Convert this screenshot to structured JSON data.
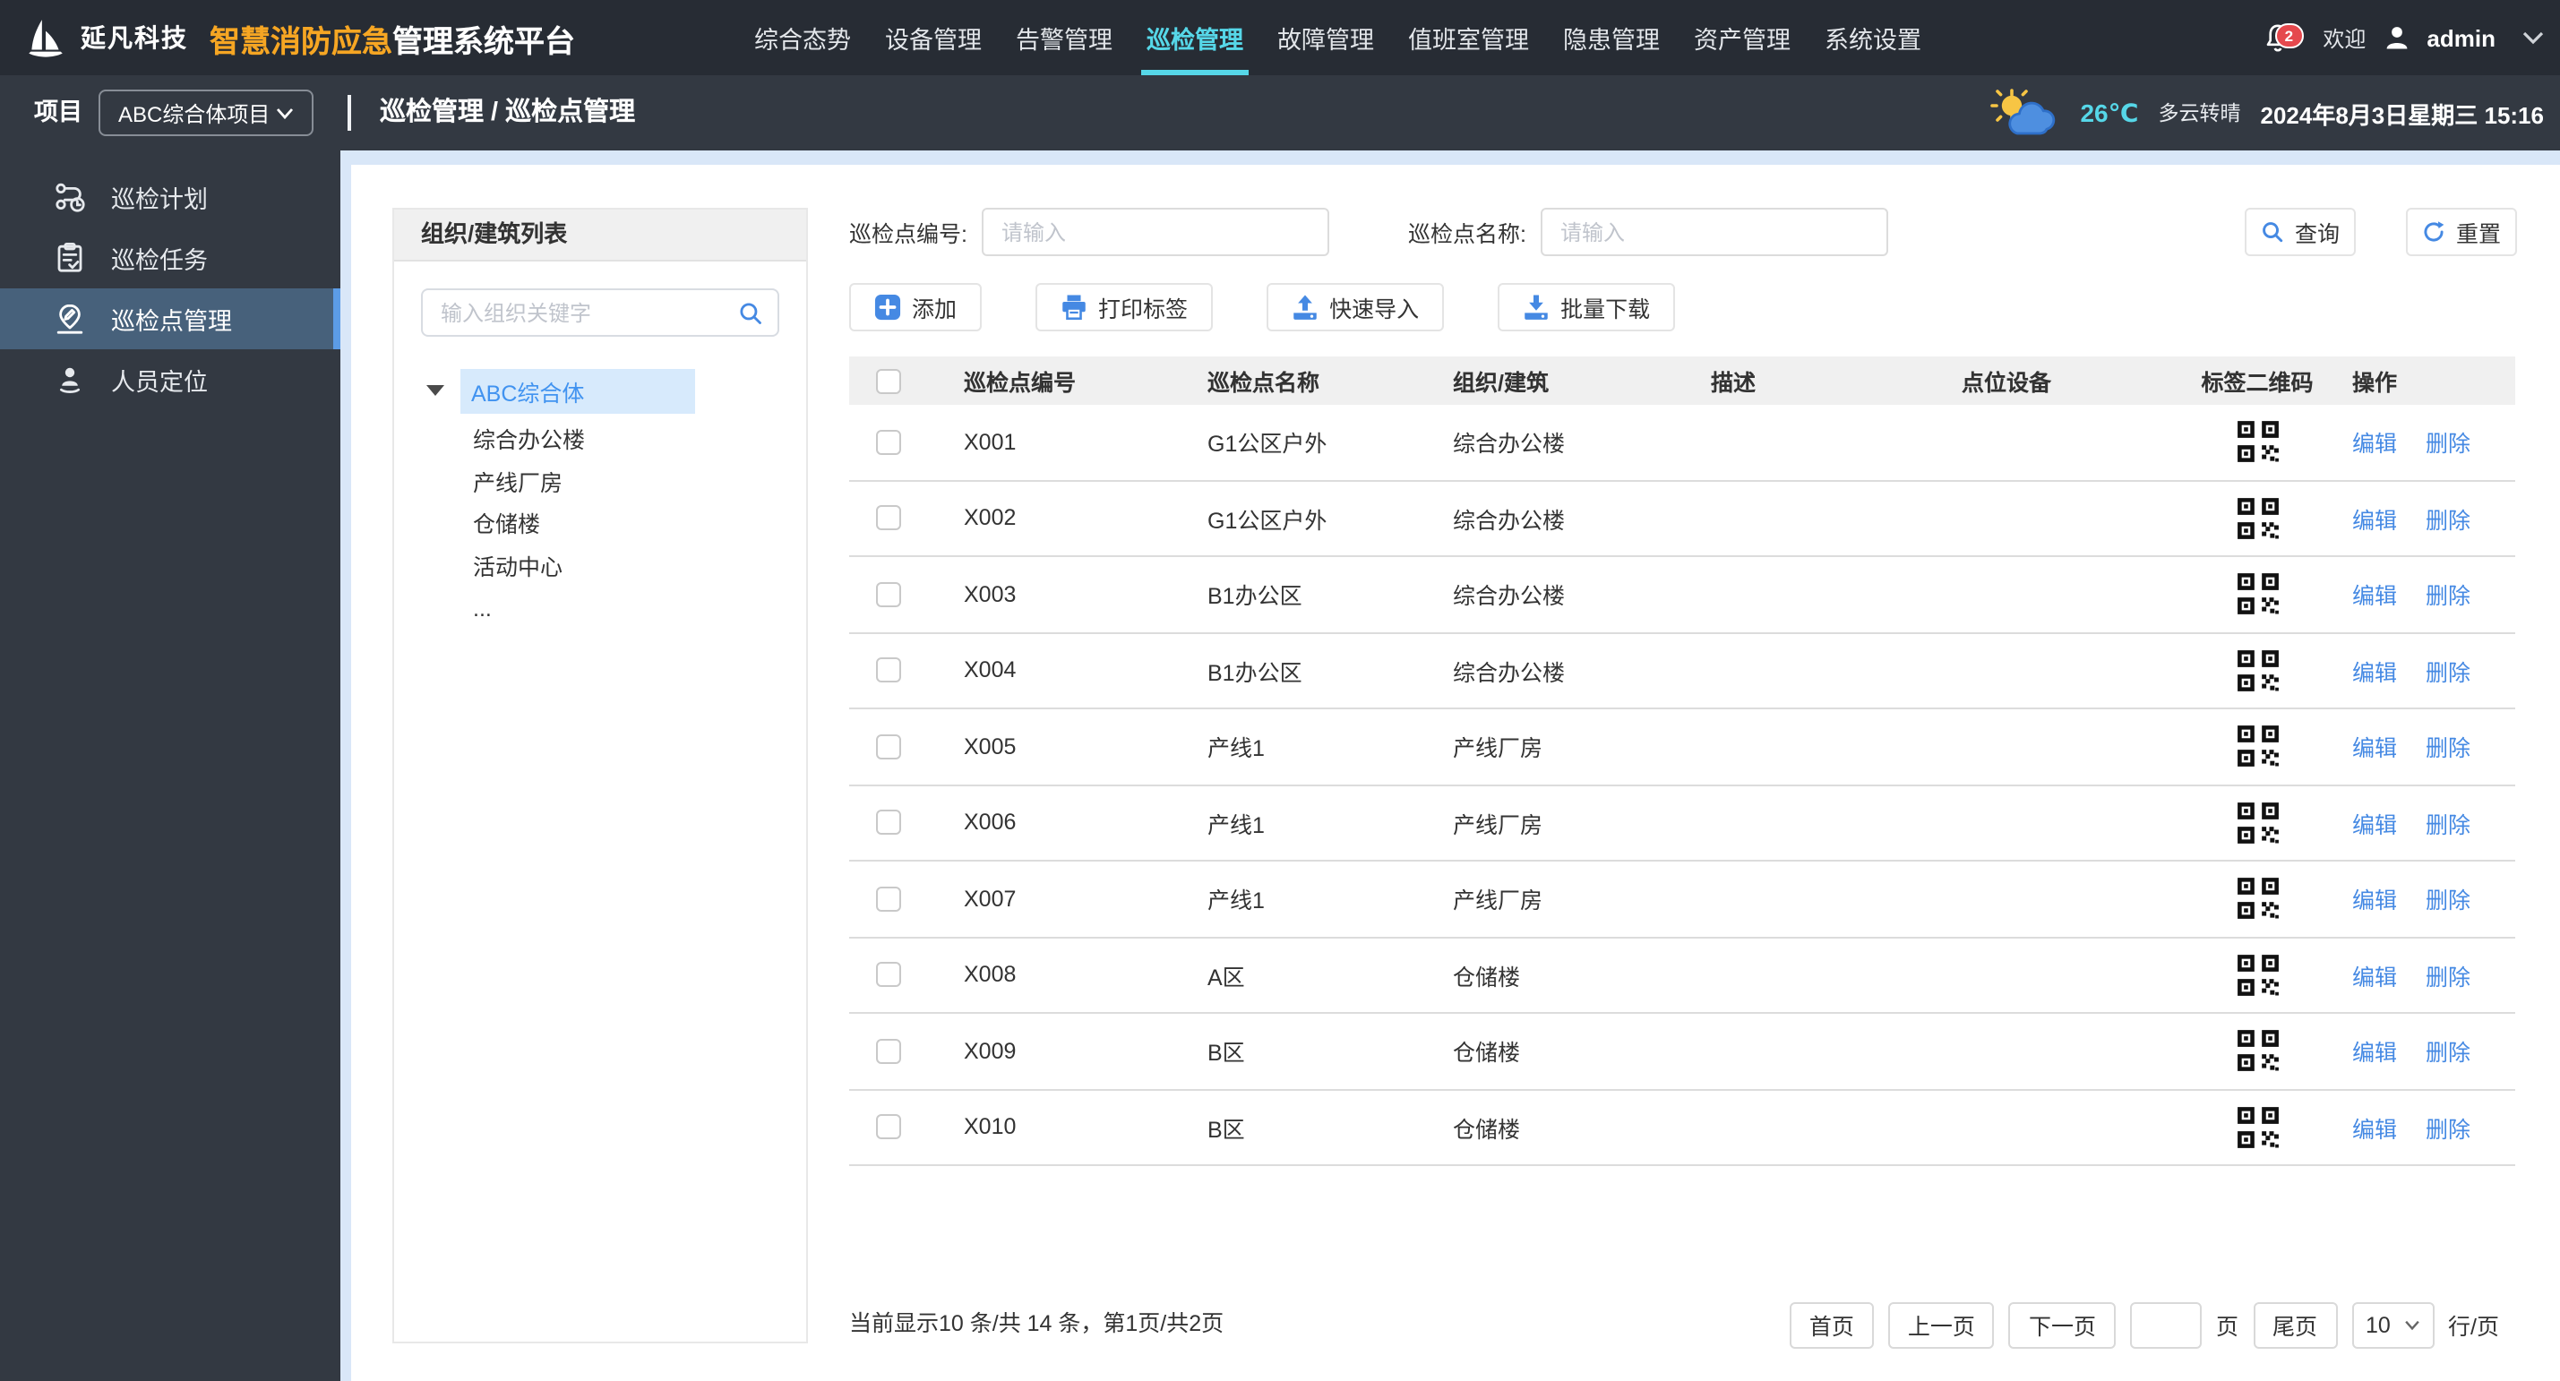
{
  "brand": {
    "company": "延凡科技",
    "product_highlight": "智慧消防应急",
    "product_suffix": "管理系统平台"
  },
  "topnav": {
    "active_index": 3,
    "items": [
      "综合态势",
      "设备管理",
      "告警管理",
      "巡检管理",
      "故障管理",
      "值班室管理",
      "隐患管理",
      "资产管理",
      "系统设置"
    ]
  },
  "user_area": {
    "notification_count": "2",
    "welcome": "欢迎",
    "username": "admin"
  },
  "project_bar": {
    "label": "项目",
    "selected_project": "ABC综合体项目",
    "breadcrumb": "巡检管理 / 巡检点管理"
  },
  "weather": {
    "temperature": "26℃",
    "condition": "多云转晴",
    "datetime": "2024年8月3日星期三 15:16"
  },
  "sidebar": {
    "active_index": 2,
    "items": [
      "巡检计划",
      "巡检任务",
      "巡检点管理",
      "人员定位"
    ]
  },
  "org_panel": {
    "title": "组织/建筑列表",
    "search_placeholder": "输入组织关键字",
    "tree_root": "ABC综合体",
    "tree_children": [
      "综合办公楼",
      "产线厂房",
      "仓储楼",
      "活动中心",
      "..."
    ]
  },
  "filters": {
    "point_code_label": "巡检点编号:",
    "point_code_placeholder": "请输入",
    "point_name_label": "巡检点名称:",
    "point_name_placeholder": "请输入",
    "query": "查询",
    "reset": "重置"
  },
  "toolbar": {
    "add": "添加",
    "print": "打印标签",
    "import": "快速导入",
    "download": "批量下载"
  },
  "table": {
    "columns": [
      "巡检点编号",
      "巡检点名称",
      "组织/建筑",
      "描述",
      "点位设备",
      "标签二维码",
      "操作"
    ],
    "edit": "编辑",
    "delete": "删除",
    "rows": [
      {
        "code": "X001",
        "name": "G1公区户外",
        "org": "综合办公楼",
        "desc": "",
        "device": ""
      },
      {
        "code": "X002",
        "name": "G1公区户外",
        "org": "综合办公楼",
        "desc": "",
        "device": ""
      },
      {
        "code": "X003",
        "name": "B1办公区",
        "org": "综合办公楼",
        "desc": "",
        "device": ""
      },
      {
        "code": "X004",
        "name": "B1办公区",
        "org": "综合办公楼",
        "desc": "",
        "device": ""
      },
      {
        "code": "X005",
        "name": "产线1",
        "org": "产线厂房",
        "desc": "",
        "device": ""
      },
      {
        "code": "X006",
        "name": "产线1",
        "org": "产线厂房",
        "desc": "",
        "device": ""
      },
      {
        "code": "X007",
        "name": "产线1",
        "org": "产线厂房",
        "desc": "",
        "device": ""
      },
      {
        "code": "X008",
        "name": "A区",
        "org": "仓储楼",
        "desc": "",
        "device": ""
      },
      {
        "code": "X009",
        "name": "B区",
        "org": "仓储楼",
        "desc": "",
        "device": ""
      },
      {
        "code": "X010",
        "name": "B区",
        "org": "仓储楼",
        "desc": "",
        "device": ""
      }
    ]
  },
  "pagination": {
    "status": "当前显示10 条/共 14 条，第1页/共2页",
    "first": "首页",
    "prev": "上一页",
    "next": "下一页",
    "page_input": "",
    "page_unit": "页",
    "last": "尾页",
    "page_size": "10",
    "per_page": "行/页"
  },
  "colors": {
    "topbar_bg": "#272C34",
    "sidebar_bg": "#333942",
    "accent_cyan": "#56D7E8",
    "accent_orange": "#F6A623",
    "accent_blue": "#4589E3",
    "sidebar_active_bg": "#47617B",
    "sidebar_active_stripe": "#5C9CE6",
    "tree_highlight_bg": "#D7EAFC",
    "tree_highlight_text": "#4193F0",
    "content_bg": "#D9E7F8",
    "header_row_bg": "#F0F0F0",
    "badge_red": "#E5484D"
  }
}
